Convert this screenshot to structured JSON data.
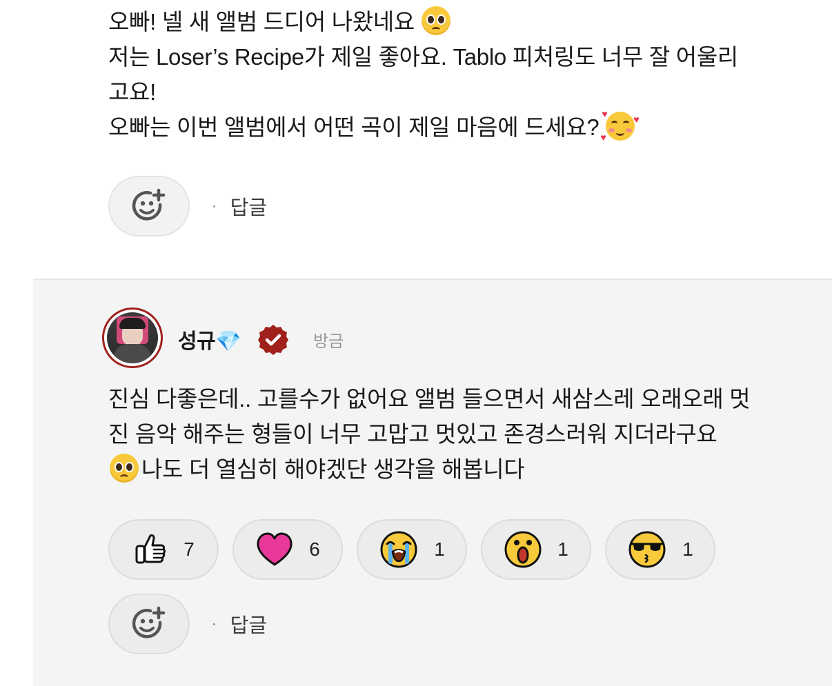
{
  "post": {
    "lines": [
      "오빠! 넬 새 앨범 드디어 나왔네요",
      "저는 Loser’s Recipe가 제일 좋아요. Tablo 피처링도 너무 잘 어울리",
      "고요!",
      "오빠는 이번 앨범에서 어떤 곡이 제일 마음에 드세요?"
    ],
    "emoji_line1": "pleading-face-emoji",
    "emoji_line4": "smiling-face-with-hearts-emoji",
    "reply_label": "답글",
    "separator": "·"
  },
  "reply": {
    "username": "성규💎",
    "timestamp": "방금",
    "lines": [
      "진심 다좋은데.. 고를수가 없어요 앨범 들으면서 새삼스레 오래오래 멋",
      "진 음악 해주는 형들이 너무 고맙고 멋있고 존경스러워 지더라구요",
      "나도 더 열심히 해야겠단 생각을 해봅니다"
    ],
    "reactions": [
      {
        "icon": "thumbs-up-icon",
        "count": "7"
      },
      {
        "icon": "heart-icon",
        "count": "6"
      },
      {
        "icon": "crying-face-icon",
        "count": "1"
      },
      {
        "icon": "surprised-face-icon",
        "count": "1"
      },
      {
        "icon": "sunglasses-face-icon",
        "count": "1"
      }
    ],
    "reply_label": "답글",
    "separator": "·"
  },
  "colors": {
    "verified_badge": "#a0201c",
    "heart": "#e8389a",
    "emoji_yellow": "#f8c93a",
    "reply_background": "#f4f4f4"
  }
}
